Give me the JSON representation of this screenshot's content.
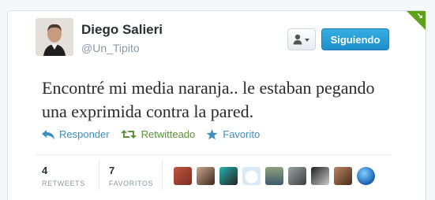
{
  "user": {
    "display_name": "Diego Salieri",
    "handle": "@Un_Tipito"
  },
  "buttons": {
    "user_dropdown_icon": "person-icon",
    "follow_label": "Siguiendo"
  },
  "tweet": {
    "text": "Encontré mi media naranja.. le estaban pegando una exprimida contra la pared."
  },
  "actions": {
    "reply_label": "Responder",
    "retweet_label": "Retwitteado",
    "favorite_label": "Favorito"
  },
  "stats": {
    "retweets_count": "4",
    "retweets_label": "RETWEETS",
    "favorites_count": "7",
    "favorites_label": "FAVORITOS"
  },
  "colors": {
    "accent": "#3b8fc1",
    "retweeted": "#5c913b",
    "follow_button": "#2b9fd8",
    "corner_flag": "#5ea01a"
  }
}
